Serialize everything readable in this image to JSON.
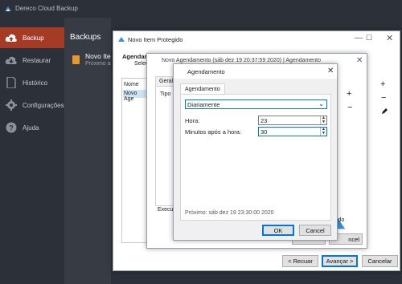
{
  "app": {
    "title": "Dereco Cloud Backup"
  },
  "sidebar": {
    "items": [
      {
        "label": "Backup",
        "icon": "cloud-upload-icon"
      },
      {
        "label": "Restaurar",
        "icon": "cloud-download-icon"
      },
      {
        "label": "Histórico",
        "icon": "document-icon"
      },
      {
        "label": "Configurações",
        "icon": "gear-icon"
      },
      {
        "label": "Ajuda",
        "icon": "help-icon"
      }
    ]
  },
  "backups_panel": {
    "title": "Backups",
    "item_title": "Novo Item",
    "item_subtitle": "Próximo ag"
  },
  "protected_window": {
    "title": "Novo Item Protegido",
    "heading": "Agendame",
    "subheading": "Selec",
    "list_header": "Nome",
    "list_item": "Novo Age",
    "right_buttons": [
      "+",
      "−"
    ],
    "back_label": "< Recuar",
    "next_label": "Avançar >",
    "cancel_label": "Cancelar"
  },
  "schedule_window": {
    "title": "Novo Agendamento (sáb dez 19 20:37:59 2020) | Agendamento",
    "tab_label": "Geral",
    "column_label": "Tipo",
    "exec_label": "Execut",
    "right_partial": "ido",
    "right_buttons": [
      "+",
      "−"
    ],
    "partial_cancel": "ncel"
  },
  "dialog": {
    "title": "Agendamento",
    "tab_label": "Agendamento",
    "frequency_value": "Diariamente",
    "hour_label": "Hora:",
    "hour_value": "23",
    "minutes_label": "Minutos após a hora:",
    "minutes_value": "30",
    "next_run": "Próximo: sáb dez 19 23:30:00 2020",
    "ok_label": "OK",
    "cancel_label": "Cancel"
  },
  "colors": {
    "accent": "#a53a25",
    "sidebar": "#2b3039",
    "panel": "#363b44",
    "focus": "#0078d7"
  }
}
